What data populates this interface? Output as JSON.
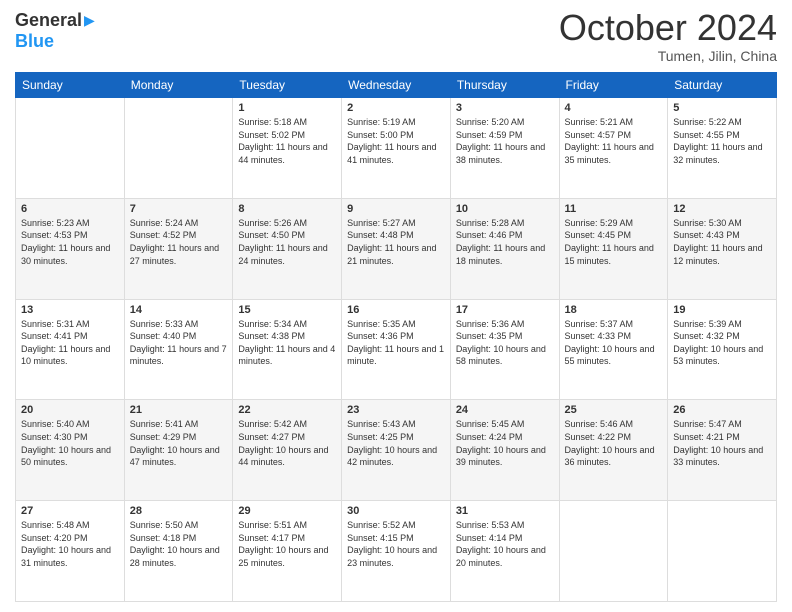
{
  "header": {
    "logo_general": "General",
    "logo_blue": "Blue",
    "month_title": "October 2024",
    "location": "Tumen, Jilin, China"
  },
  "days_of_week": [
    "Sunday",
    "Monday",
    "Tuesday",
    "Wednesday",
    "Thursday",
    "Friday",
    "Saturday"
  ],
  "weeks": [
    [
      {
        "day": "",
        "sunrise": "",
        "sunset": "",
        "daylight": ""
      },
      {
        "day": "",
        "sunrise": "",
        "sunset": "",
        "daylight": ""
      },
      {
        "day": "1",
        "sunrise": "Sunrise: 5:18 AM",
        "sunset": "Sunset: 5:02 PM",
        "daylight": "Daylight: 11 hours and 44 minutes."
      },
      {
        "day": "2",
        "sunrise": "Sunrise: 5:19 AM",
        "sunset": "Sunset: 5:00 PM",
        "daylight": "Daylight: 11 hours and 41 minutes."
      },
      {
        "day": "3",
        "sunrise": "Sunrise: 5:20 AM",
        "sunset": "Sunset: 4:59 PM",
        "daylight": "Daylight: 11 hours and 38 minutes."
      },
      {
        "day": "4",
        "sunrise": "Sunrise: 5:21 AM",
        "sunset": "Sunset: 4:57 PM",
        "daylight": "Daylight: 11 hours and 35 minutes."
      },
      {
        "day": "5",
        "sunrise": "Sunrise: 5:22 AM",
        "sunset": "Sunset: 4:55 PM",
        "daylight": "Daylight: 11 hours and 32 minutes."
      }
    ],
    [
      {
        "day": "6",
        "sunrise": "Sunrise: 5:23 AM",
        "sunset": "Sunset: 4:53 PM",
        "daylight": "Daylight: 11 hours and 30 minutes."
      },
      {
        "day": "7",
        "sunrise": "Sunrise: 5:24 AM",
        "sunset": "Sunset: 4:52 PM",
        "daylight": "Daylight: 11 hours and 27 minutes."
      },
      {
        "day": "8",
        "sunrise": "Sunrise: 5:26 AM",
        "sunset": "Sunset: 4:50 PM",
        "daylight": "Daylight: 11 hours and 24 minutes."
      },
      {
        "day": "9",
        "sunrise": "Sunrise: 5:27 AM",
        "sunset": "Sunset: 4:48 PM",
        "daylight": "Daylight: 11 hours and 21 minutes."
      },
      {
        "day": "10",
        "sunrise": "Sunrise: 5:28 AM",
        "sunset": "Sunset: 4:46 PM",
        "daylight": "Daylight: 11 hours and 18 minutes."
      },
      {
        "day": "11",
        "sunrise": "Sunrise: 5:29 AM",
        "sunset": "Sunset: 4:45 PM",
        "daylight": "Daylight: 11 hours and 15 minutes."
      },
      {
        "day": "12",
        "sunrise": "Sunrise: 5:30 AM",
        "sunset": "Sunset: 4:43 PM",
        "daylight": "Daylight: 11 hours and 12 minutes."
      }
    ],
    [
      {
        "day": "13",
        "sunrise": "Sunrise: 5:31 AM",
        "sunset": "Sunset: 4:41 PM",
        "daylight": "Daylight: 11 hours and 10 minutes."
      },
      {
        "day": "14",
        "sunrise": "Sunrise: 5:33 AM",
        "sunset": "Sunset: 4:40 PM",
        "daylight": "Daylight: 11 hours and 7 minutes."
      },
      {
        "day": "15",
        "sunrise": "Sunrise: 5:34 AM",
        "sunset": "Sunset: 4:38 PM",
        "daylight": "Daylight: 11 hours and 4 minutes."
      },
      {
        "day": "16",
        "sunrise": "Sunrise: 5:35 AM",
        "sunset": "Sunset: 4:36 PM",
        "daylight": "Daylight: 11 hours and 1 minute."
      },
      {
        "day": "17",
        "sunrise": "Sunrise: 5:36 AM",
        "sunset": "Sunset: 4:35 PM",
        "daylight": "Daylight: 10 hours and 58 minutes."
      },
      {
        "day": "18",
        "sunrise": "Sunrise: 5:37 AM",
        "sunset": "Sunset: 4:33 PM",
        "daylight": "Daylight: 10 hours and 55 minutes."
      },
      {
        "day": "19",
        "sunrise": "Sunrise: 5:39 AM",
        "sunset": "Sunset: 4:32 PM",
        "daylight": "Daylight: 10 hours and 53 minutes."
      }
    ],
    [
      {
        "day": "20",
        "sunrise": "Sunrise: 5:40 AM",
        "sunset": "Sunset: 4:30 PM",
        "daylight": "Daylight: 10 hours and 50 minutes."
      },
      {
        "day": "21",
        "sunrise": "Sunrise: 5:41 AM",
        "sunset": "Sunset: 4:29 PM",
        "daylight": "Daylight: 10 hours and 47 minutes."
      },
      {
        "day": "22",
        "sunrise": "Sunrise: 5:42 AM",
        "sunset": "Sunset: 4:27 PM",
        "daylight": "Daylight: 10 hours and 44 minutes."
      },
      {
        "day": "23",
        "sunrise": "Sunrise: 5:43 AM",
        "sunset": "Sunset: 4:25 PM",
        "daylight": "Daylight: 10 hours and 42 minutes."
      },
      {
        "day": "24",
        "sunrise": "Sunrise: 5:45 AM",
        "sunset": "Sunset: 4:24 PM",
        "daylight": "Daylight: 10 hours and 39 minutes."
      },
      {
        "day": "25",
        "sunrise": "Sunrise: 5:46 AM",
        "sunset": "Sunset: 4:22 PM",
        "daylight": "Daylight: 10 hours and 36 minutes."
      },
      {
        "day": "26",
        "sunrise": "Sunrise: 5:47 AM",
        "sunset": "Sunset: 4:21 PM",
        "daylight": "Daylight: 10 hours and 33 minutes."
      }
    ],
    [
      {
        "day": "27",
        "sunrise": "Sunrise: 5:48 AM",
        "sunset": "Sunset: 4:20 PM",
        "daylight": "Daylight: 10 hours and 31 minutes."
      },
      {
        "day": "28",
        "sunrise": "Sunrise: 5:50 AM",
        "sunset": "Sunset: 4:18 PM",
        "daylight": "Daylight: 10 hours and 28 minutes."
      },
      {
        "day": "29",
        "sunrise": "Sunrise: 5:51 AM",
        "sunset": "Sunset: 4:17 PM",
        "daylight": "Daylight: 10 hours and 25 minutes."
      },
      {
        "day": "30",
        "sunrise": "Sunrise: 5:52 AM",
        "sunset": "Sunset: 4:15 PM",
        "daylight": "Daylight: 10 hours and 23 minutes."
      },
      {
        "day": "31",
        "sunrise": "Sunrise: 5:53 AM",
        "sunset": "Sunset: 4:14 PM",
        "daylight": "Daylight: 10 hours and 20 minutes."
      },
      {
        "day": "",
        "sunrise": "",
        "sunset": "",
        "daylight": ""
      },
      {
        "day": "",
        "sunrise": "",
        "sunset": "",
        "daylight": ""
      }
    ]
  ]
}
